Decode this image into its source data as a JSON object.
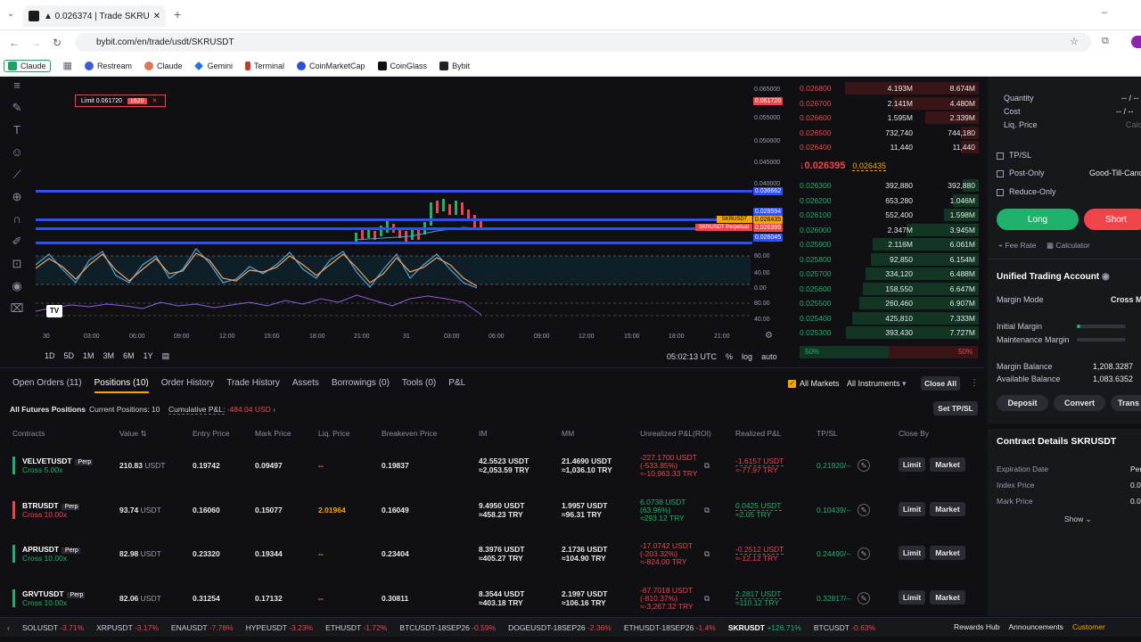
{
  "browser": {
    "tab_title": "▲ 0.026374 | Trade SKRUSDT | B",
    "url": "bybit.com/en/trade/usdt/SKRUSDT",
    "bookmarks": [
      "Claude",
      "Restream",
      "Claude",
      "Gemini",
      "Terminal",
      "CoinMarketCap",
      "CoinGlass",
      "Bybit"
    ],
    "bookmark_colors": [
      "#1aa260",
      "#3b5bdb",
      "#d97757",
      "#1a73e8",
      "#c0392b",
      "#2f4fd8",
      "#111111",
      "#222222"
    ]
  },
  "chart": {
    "limit_label": "Limit 0.061720",
    "limit_qty": "1620",
    "axis_prices": [
      "0.065000",
      "0.061720",
      "0.055000",
      "0.050000",
      "0.045000",
      "0.040000",
      "0.036662",
      "0.028594",
      "0.026435",
      "0.026395",
      "0.026045",
      "80.00",
      "40.00",
      "0.00",
      "80.00",
      "40.00"
    ],
    "markers": [
      "SKRUSDT",
      "SKRUSDT Perpetual"
    ],
    "time_labels": [
      "30",
      "03:00",
      "06:00",
      "09:00",
      "12:00",
      "15:00",
      "18:00",
      "21:00",
      "31",
      "03:00",
      "06:00",
      "09:00",
      "12:00",
      "15:00",
      "18:00",
      "21:00"
    ],
    "ranges": [
      "1D",
      "5D",
      "1M",
      "3M",
      "6M",
      "1Y"
    ],
    "clock": "05:02:13 UTC",
    "scale_opts": [
      "%",
      "log",
      "auto"
    ]
  },
  "orderbook": {
    "asks": [
      [
        "0.026800",
        "4.193M",
        "8.674M"
      ],
      [
        "0.026700",
        "2.141M",
        "4.480M"
      ],
      [
        "0.026600",
        "1.595M",
        "2.339M"
      ],
      [
        "0.026500",
        "732,740",
        "744,180"
      ],
      [
        "0.026400",
        "11,440",
        "11,440"
      ]
    ],
    "last_price": "↓0.026395",
    "mark_price": "0.026435",
    "bids": [
      [
        "0.026300",
        "392,880",
        "392,880"
      ],
      [
        "0.026200",
        "653,280",
        "1.046M"
      ],
      [
        "0.026100",
        "552,400",
        "1.598M"
      ],
      [
        "0.026000",
        "2.347M",
        "3.945M"
      ],
      [
        "0.025900",
        "2.116M",
        "6.061M"
      ],
      [
        "0.025800",
        "92,850",
        "6.154M"
      ],
      [
        "0.025700",
        "334,120",
        "6.488M"
      ],
      [
        "0.025600",
        "158,550",
        "6.647M"
      ],
      [
        "0.025500",
        "260,460",
        "6.907M"
      ],
      [
        "0.025400",
        "425,810",
        "7.333M"
      ],
      [
        "0.025300",
        "393,430",
        "7.727M"
      ]
    ],
    "ratio_buy": "50%",
    "ratio_sell": "50%"
  },
  "panel": {
    "quantity": "Quantity",
    "cost": "Cost",
    "liq": "Liq. Price",
    "dash1": "-- / --",
    "dash2": "-- / --",
    "calc": "Calc",
    "tpsl": "TP/SL",
    "post_only": "Post-Only",
    "gtc": "Good-Till-Canc",
    "reduce_only": "Reduce-Only",
    "long": "Long",
    "short": "Short",
    "fee_rate": "Fee Rate",
    "calculator": "Calculator",
    "uta": "Unified Trading Account",
    "margin_mode": "Margin Mode",
    "margin_mode_val": "Cross M",
    "initial_margin": "Initial Margin",
    "maintenance_margin": "Maintenance Margin",
    "margin_balance": "Margin Balance",
    "margin_balance_val": "1,208.3287",
    "available_balance": "Available Balance",
    "available_balance_val": "1,083.6352",
    "deposit": "Deposit",
    "convert": "Convert",
    "transfer": "Trans",
    "contract_details": "Contract Details SKRUSDT",
    "expiration": "Expiration Date",
    "expiration_val": "Per",
    "index_price": "Index Price",
    "index_val": "0.0",
    "mark_price": "Mark Price",
    "mark_val": "0.0",
    "show": "Show"
  },
  "positions": {
    "tabs": [
      "Open Orders (11)",
      "Positions (10)",
      "Order History",
      "Trade History",
      "Assets",
      "Borrowings (0)",
      "Tools (0)",
      "P&L"
    ],
    "all_markets": "All Markets",
    "all_instruments": "All Instruments",
    "close_all": "Close All",
    "all_futures": "All Futures Positions",
    "current_positions": "Current Positions: 10",
    "cum_pnl_label": "Cumulative P&L:",
    "cum_pnl_val": "-484.04 USD",
    "set_tpsl": "Set TP/SL",
    "headers": [
      "Contracts",
      "Value",
      "Entry Price",
      "Mark Price",
      "Liq. Price",
      "Breakeven Price",
      "IM",
      "MM",
      "Unrealized P&L(ROI)",
      "Realized P&L",
      "TP/SL",
      "Close By"
    ],
    "rows": [
      {
        "sym": "VELVETUSDT",
        "tag": "Perp",
        "mode": "Cross 5.00x",
        "side": "long",
        "value": "210.83",
        "unit": "USDT",
        "entry": "0.19742",
        "mark": "0.09497",
        "liq": "--",
        "be": "0.19837",
        "im1": "42.5523 USDT",
        "im2": "≈2,053.59 TRY",
        "mm1": "21.4690 USDT",
        "mm2": "≈1,036.10 TRY",
        "up1": "-227.1700 USDT",
        "up2": "(-533.85%)",
        "up3": "≈-10,963.33 TRY",
        "rp1": "-1.6157 USDT",
        "rp2": "≈-77.97 TRY",
        "tp": "0.21920/--"
      },
      {
        "sym": "BTRUSDT",
        "tag": "Perp",
        "mode": "Cross 10.00x",
        "side": "short",
        "value": "93.74",
        "unit": "USDT",
        "entry": "0.16060",
        "mark": "0.15077",
        "liq": "2.01964",
        "be": "0.16049",
        "im1": "9.4950 USDT",
        "im2": "≈458.23 TRY",
        "mm1": "1.9957 USDT",
        "mm2": "≈96.31 TRY",
        "up1": "6.0738 USDT",
        "up2": "(63.96%)",
        "up3": "≈293.12 TRY",
        "rp1": "0.0425 USDT",
        "rp2": "≈2.05 TRY",
        "tp": "0.10439/--"
      },
      {
        "sym": "APRUSDT",
        "tag": "Perp",
        "mode": "Cross 10.00x",
        "side": "long",
        "value": "82.98",
        "unit": "USDT",
        "entry": "0.23320",
        "mark": "0.19344",
        "liq": "--",
        "be": "0.23404",
        "im1": "8.3976 USDT",
        "im2": "≈405.27 TRY",
        "mm1": "2.1736 USDT",
        "mm2": "≈104.90 TRY",
        "up1": "-17.0742 USDT",
        "up2": "(-203.32%)",
        "up3": "≈-824.00 TRY",
        "rp1": "-0.2512 USDT",
        "rp2": "≈-12.12 TRY",
        "tp": "0.24490/--"
      },
      {
        "sym": "GRVTUSDT",
        "tag": "Perp",
        "mode": "Cross 10.00x",
        "side": "long",
        "value": "82.06",
        "unit": "USDT",
        "entry": "0.31254",
        "mark": "0.17132",
        "liq": "--",
        "be": "0.30811",
        "im1": "8.3544 USDT",
        "im2": "≈403.18 TRY",
        "mm1": "2.1997 USDT",
        "mm2": "≈106.16 TRY",
        "up1": "-67.7018 USDT",
        "up2": "(-810.37%)",
        "up3": "≈-3,267.32 TRY",
        "rp1": "2.2817 USDT",
        "rp2": "≈110.12 TRY",
        "tp": "0.32817/--"
      }
    ],
    "limit": "Limit",
    "market": "Market"
  },
  "ticker": [
    [
      "SOLUSDT",
      "-3.71%"
    ],
    [
      "XRPUSDT",
      "-3.17%"
    ],
    [
      "ENAUSDT",
      "-7.78%"
    ],
    [
      "HYPEUSDT",
      "-3.23%"
    ],
    [
      "ETHUSDT",
      "-1.72%"
    ],
    [
      "BTCUSDT-18SEP26",
      "-0.59%"
    ],
    [
      "DOGEUSDT-18SEP26",
      "-2.36%"
    ],
    [
      "ETHUSDT-18SEP26",
      "-1.4%"
    ],
    [
      "SKRUSDT",
      "+126.71%"
    ],
    [
      "BTCUSDT",
      "-0.63%"
    ]
  ],
  "ticker_right": [
    "Rewards Hub",
    "Announcements",
    "Customer"
  ]
}
